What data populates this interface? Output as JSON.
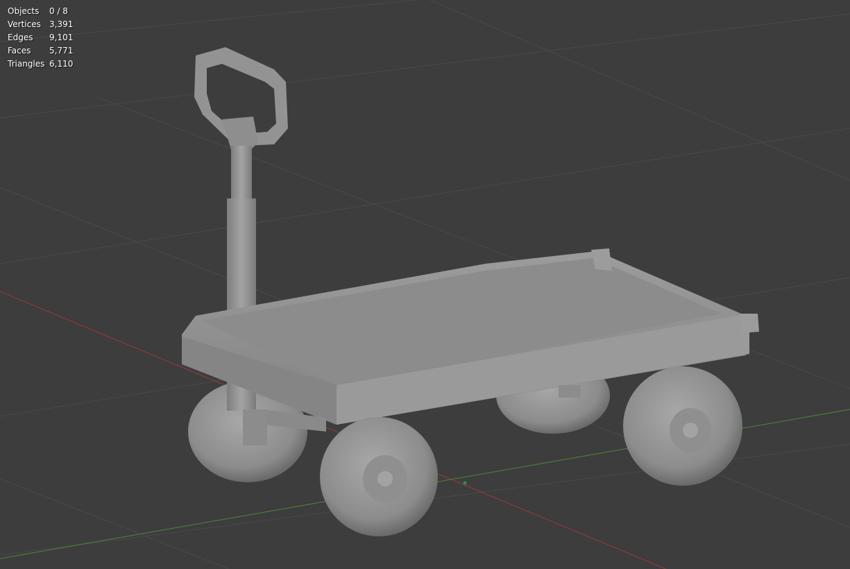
{
  "stats": {
    "objects": {
      "label": "Objects",
      "value": "0 / 8"
    },
    "vertices": {
      "label": "Vertices",
      "value": "3,391"
    },
    "edges": {
      "label": "Edges",
      "value": "9,101"
    },
    "faces": {
      "label": "Faces",
      "value": "5,771"
    },
    "triangles": {
      "label": "Triangles",
      "value": "6,110"
    }
  },
  "colors": {
    "background": "#3d3d3d",
    "grid": "#4a4a4a",
    "x_axis": "#8a3b3b",
    "y_axis": "#4d7a3b",
    "model": "#9a9a9a"
  }
}
